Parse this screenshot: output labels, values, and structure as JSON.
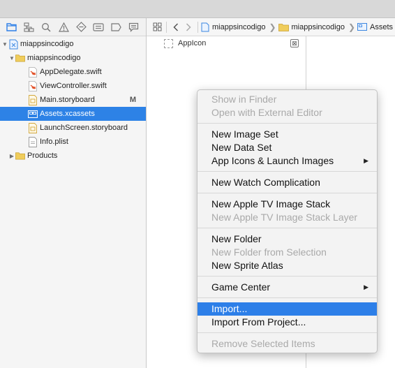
{
  "navigator": {
    "tree": [
      {
        "label": "miappsincodigo",
        "kind": "project",
        "indent": 0,
        "disclosure": "open"
      },
      {
        "label": "miappsincodigo",
        "kind": "folder",
        "indent": 1,
        "disclosure": "open"
      },
      {
        "label": "AppDelegate.swift",
        "kind": "swift",
        "indent": 2
      },
      {
        "label": "ViewController.swift",
        "kind": "swift",
        "indent": 2
      },
      {
        "label": "Main.storyboard",
        "kind": "storyboard",
        "indent": 2,
        "badge": "M"
      },
      {
        "label": "Assets.xcassets",
        "kind": "assets",
        "indent": 2,
        "selected": true
      },
      {
        "label": "LaunchScreen.storyboard",
        "kind": "storyboard",
        "indent": 2
      },
      {
        "label": "Info.plist",
        "kind": "plist",
        "indent": 2
      },
      {
        "label": "Products",
        "kind": "folder",
        "indent": 1,
        "disclosure": "closed"
      }
    ]
  },
  "jumpbar": {
    "crumbs": [
      "miappsincodigo",
      "miappsincodigo",
      "Assets"
    ]
  },
  "assets": {
    "item": "AppIcon"
  },
  "menu": {
    "groups": [
      [
        {
          "label": "Show in Finder",
          "disabled": true
        },
        {
          "label": "Open with External Editor",
          "disabled": true
        }
      ],
      [
        {
          "label": "New Image Set"
        },
        {
          "label": "New Data Set"
        },
        {
          "label": "App Icons & Launch Images",
          "submenu": true
        }
      ],
      [
        {
          "label": "New Watch Complication"
        }
      ],
      [
        {
          "label": "New Apple TV Image Stack"
        },
        {
          "label": "New Apple TV Image Stack Layer",
          "disabled": true
        }
      ],
      [
        {
          "label": "New Folder"
        },
        {
          "label": "New Folder from Selection",
          "disabled": true
        },
        {
          "label": "New Sprite Atlas"
        }
      ],
      [
        {
          "label": "Game Center",
          "submenu": true
        }
      ],
      [
        {
          "label": "Import...",
          "highlighted": true
        },
        {
          "label": "Import From Project..."
        }
      ],
      [
        {
          "label": "Remove Selected Items",
          "disabled": true
        }
      ]
    ]
  },
  "colors": {
    "selection": "#2d82e6",
    "menu_highlight": "#2d7fe8",
    "folder": "#e8c24a",
    "swift": "#e2532b"
  }
}
